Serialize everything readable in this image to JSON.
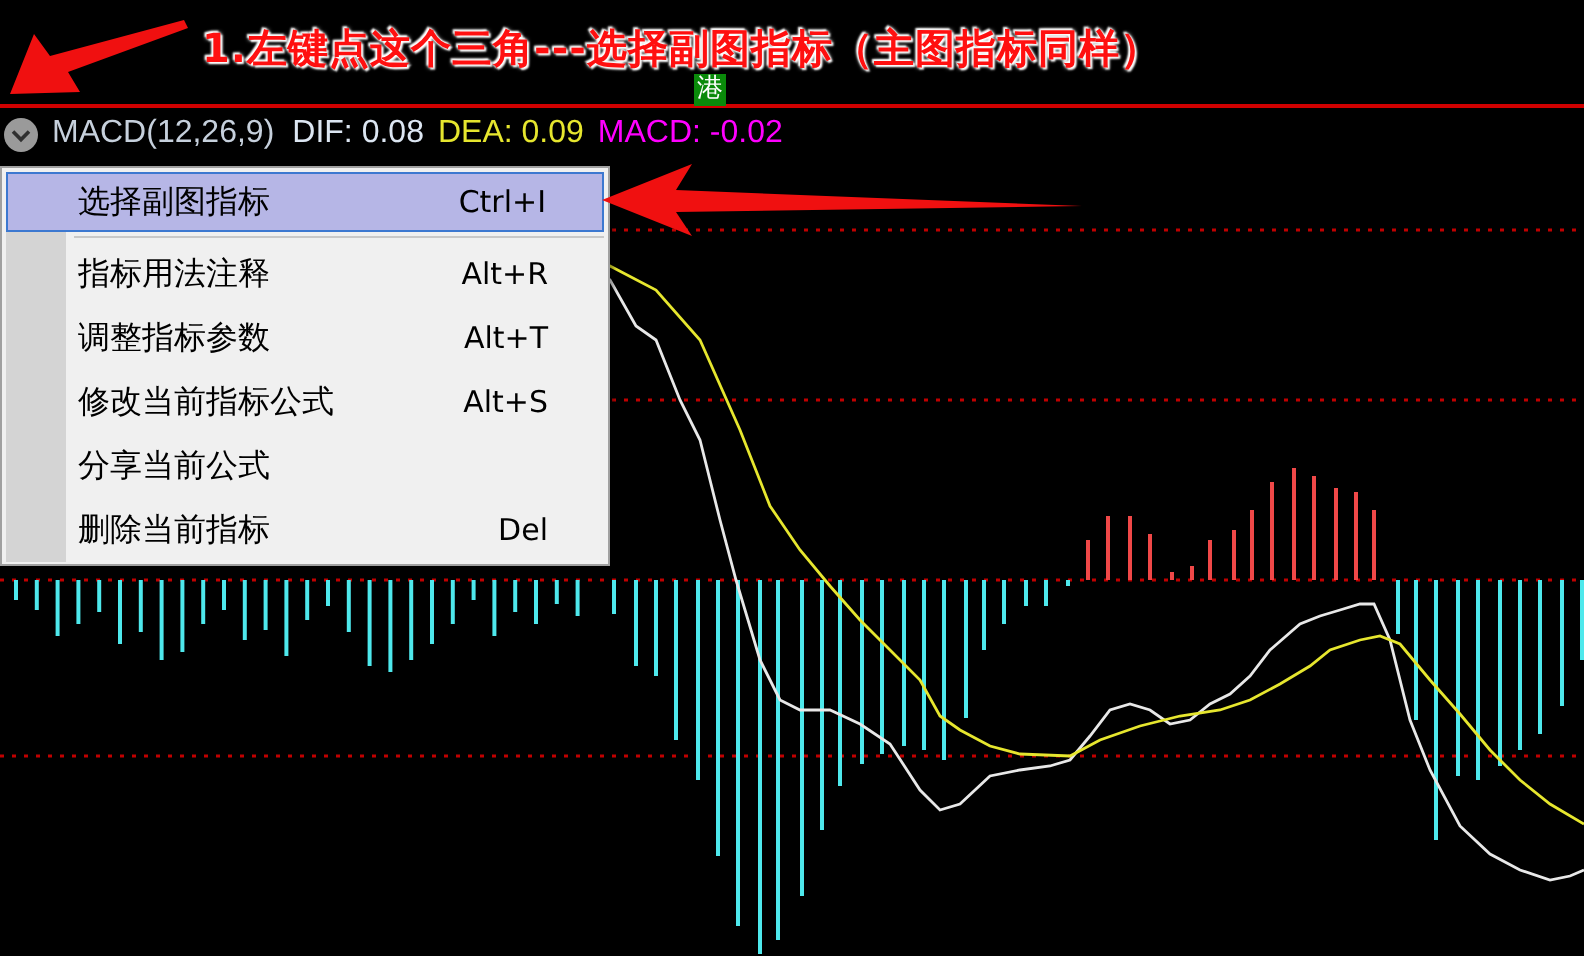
{
  "annotation": {
    "text": "1.左键点这个三角---选择副图指标（主图指标同样）"
  },
  "market_badge": {
    "text": "港"
  },
  "indicator_header": {
    "name": "MACD(12,26,9)",
    "values": [
      {
        "label": "DIF: 0.08",
        "color": "#dce6f2"
      },
      {
        "label": "DEA: 0.09",
        "color": "#e6e62e"
      },
      {
        "label": "MACD: -0.02",
        "color": "#ff00ff"
      }
    ]
  },
  "context_menu": {
    "items": [
      {
        "kind": "item",
        "label": "选择副图指标",
        "shortcut": "Ctrl+I",
        "selected": true
      },
      {
        "kind": "separator"
      },
      {
        "kind": "item",
        "label": "指标用法注释",
        "shortcut": "Alt+R",
        "selected": false
      },
      {
        "kind": "item",
        "label": "调整指标参数",
        "shortcut": "Alt+T",
        "selected": false
      },
      {
        "kind": "item",
        "label": "修改当前指标公式",
        "shortcut": "Alt+S",
        "selected": false
      },
      {
        "kind": "item",
        "label": "分享当前公式",
        "selected": false
      },
      {
        "kind": "item",
        "label": "删除当前指标",
        "shortcut": "Del",
        "selected": false
      }
    ]
  }
}
